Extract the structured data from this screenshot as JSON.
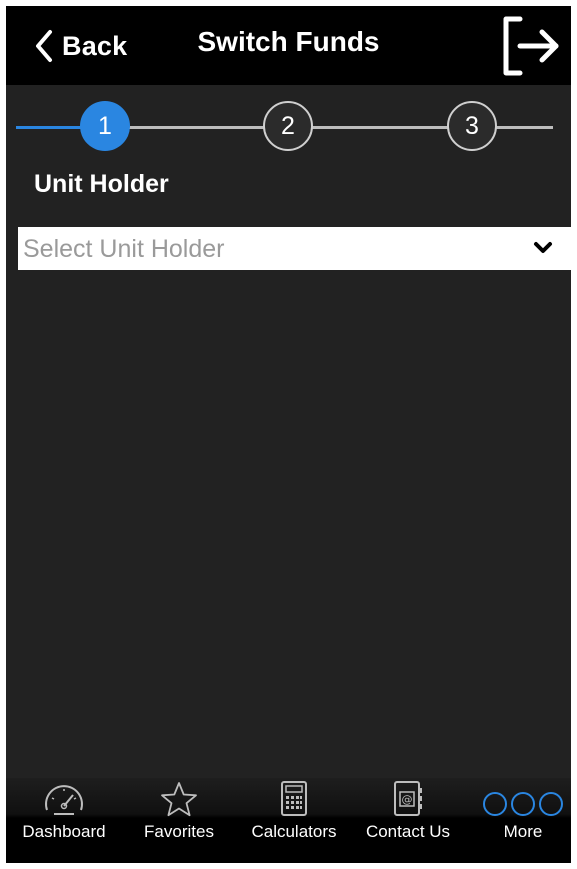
{
  "navbar": {
    "back_label": "Back",
    "title": "Switch Funds",
    "logout_icon": "logout-icon"
  },
  "stepper": {
    "steps": [
      "1",
      "2",
      "3"
    ],
    "active_step": 1,
    "active_color": "#2a86e1"
  },
  "form": {
    "unit_holder_label": "Unit Holder",
    "unit_holder_placeholder": "Select Unit Holder"
  },
  "tabbar": {
    "items": [
      {
        "label": "Dashboard",
        "icon": "speedometer-icon"
      },
      {
        "label": "Favorites",
        "icon": "star-icon"
      },
      {
        "label": "Calculators",
        "icon": "calculator-icon"
      },
      {
        "label": "Contact Us",
        "icon": "contact-book-icon"
      },
      {
        "label": "More",
        "icon": "more-icon"
      }
    ]
  },
  "colors": {
    "background": "#222222",
    "navbar": "#000000",
    "accent": "#2a86e1"
  }
}
